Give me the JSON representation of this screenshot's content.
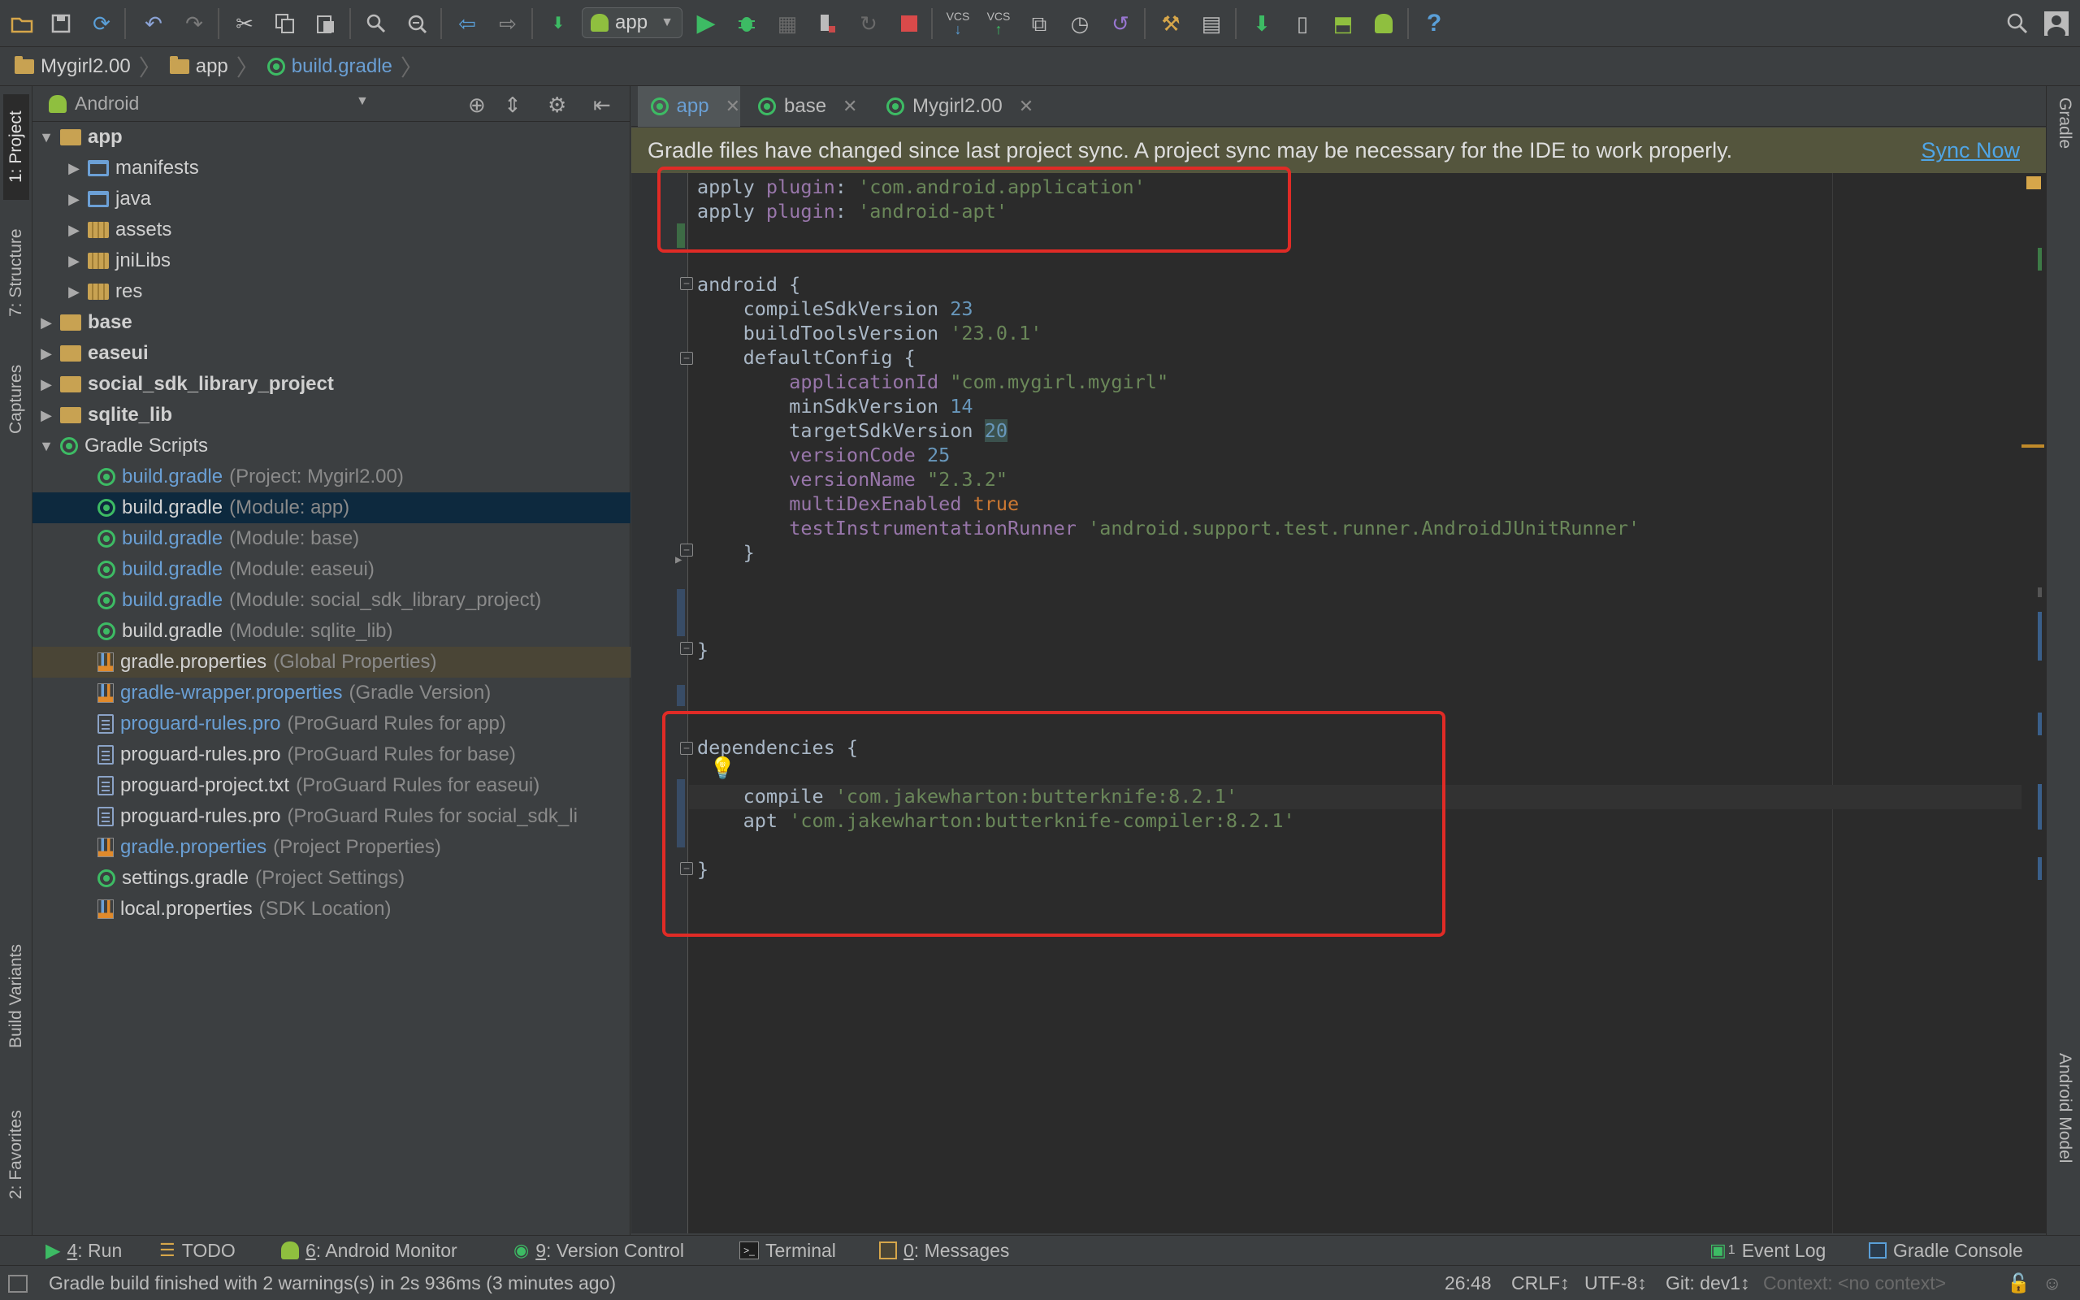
{
  "toolbar": {
    "run_config": "app",
    "icons": [
      "open-folder-icon",
      "save-icon",
      "sync-icon",
      "undo-icon",
      "redo-icon",
      "cut-icon",
      "copy-icon",
      "paste-icon",
      "find-icon",
      "replace-icon",
      "back-icon",
      "forward-icon",
      "make-project-icon",
      "run-icon",
      "debug-icon",
      "attach-debugger-icon",
      "run-coverage-icon",
      "apply-changes-icon",
      "stop-icon",
      "vcs-update-icon",
      "vcs-commit-icon",
      "vcs-compare-icon",
      "vcs-history-icon",
      "vcs-revert-icon",
      "project-structure-icon",
      "sdk-manager-icon",
      "avd-manager-icon",
      "sync-gradle-icon",
      "android-monitor-icon",
      "android-icon",
      "help-icon",
      "search-everywhere-icon",
      "user-icon"
    ],
    "vcs_label": "VCS"
  },
  "breadcrumb": [
    "Mygirl2.00",
    "app",
    "build.gradle"
  ],
  "left_strip": {
    "project": "1: Project",
    "structure": "7: Structure",
    "captures": "Captures",
    "build_variants": "Build Variants",
    "favorites": "2: Favorites"
  },
  "right_strip": {
    "gradle": "Gradle",
    "android_model": "Android Model"
  },
  "project_panel": {
    "view_mode": "Android",
    "tree": [
      {
        "label": "app",
        "hint": "",
        "depth": 0,
        "arrow": "down",
        "icon": "folder-gold",
        "style": "bold"
      },
      {
        "label": "manifests",
        "hint": "",
        "depth": 1,
        "arrow": "right",
        "icon": "folder-blue",
        "style": "white"
      },
      {
        "label": "java",
        "hint": "",
        "depth": 1,
        "arrow": "right",
        "icon": "folder-blue",
        "style": "white"
      },
      {
        "label": "assets",
        "hint": "",
        "depth": 1,
        "arrow": "right",
        "icon": "folder-stripes",
        "style": "white"
      },
      {
        "label": "jniLibs",
        "hint": "",
        "depth": 1,
        "arrow": "right",
        "icon": "folder-stripes",
        "style": "white"
      },
      {
        "label": "res",
        "hint": "",
        "depth": 1,
        "arrow": "right",
        "icon": "folder-stripes",
        "style": "white"
      },
      {
        "label": "base",
        "hint": "",
        "depth": 0,
        "arrow": "right",
        "icon": "folder-gold",
        "style": "bold"
      },
      {
        "label": "easeui",
        "hint": "",
        "depth": 0,
        "arrow": "right",
        "icon": "folder-gold",
        "style": "bold"
      },
      {
        "label": "social_sdk_library_project",
        "hint": "",
        "depth": 0,
        "arrow": "right",
        "icon": "folder-gold",
        "style": "bold"
      },
      {
        "label": "sqlite_lib",
        "hint": "",
        "depth": 0,
        "arrow": "right",
        "icon": "folder-gold",
        "style": "bold"
      },
      {
        "label": "Gradle Scripts",
        "hint": "",
        "depth": 0,
        "arrow": "down",
        "icon": "gradle",
        "style": "white"
      },
      {
        "label": "build.gradle",
        "hint": "(Project: Mygirl2.00)",
        "depth": 1,
        "arrow": "",
        "icon": "gradle",
        "style": "blue"
      },
      {
        "label": "build.gradle",
        "hint": "(Module: app)",
        "depth": 1,
        "arrow": "",
        "icon": "gradle",
        "style": "white",
        "selected": true
      },
      {
        "label": "build.gradle",
        "hint": "(Module: base)",
        "depth": 1,
        "arrow": "",
        "icon": "gradle",
        "style": "blue"
      },
      {
        "label": "build.gradle",
        "hint": "(Module: easeui)",
        "depth": 1,
        "arrow": "",
        "icon": "gradle",
        "style": "blue"
      },
      {
        "label": "build.gradle",
        "hint": "(Module: social_sdk_library_project)",
        "depth": 1,
        "arrow": "",
        "icon": "gradle",
        "style": "blue"
      },
      {
        "label": "build.gradle",
        "hint": "(Module: sqlite_lib)",
        "depth": 1,
        "arrow": "",
        "icon": "gradle",
        "style": "white"
      },
      {
        "label": "gradle.properties",
        "hint": "(Global Properties)",
        "depth": 1,
        "arrow": "",
        "icon": "props",
        "style": "white",
        "highlight": true
      },
      {
        "label": "gradle-wrapper.properties",
        "hint": "(Gradle Version)",
        "depth": 1,
        "arrow": "",
        "icon": "props",
        "style": "blue"
      },
      {
        "label": "proguard-rules.pro",
        "hint": "(ProGuard Rules for app)",
        "depth": 1,
        "arrow": "",
        "icon": "file",
        "style": "blue"
      },
      {
        "label": "proguard-rules.pro",
        "hint": "(ProGuard Rules for base)",
        "depth": 1,
        "arrow": "",
        "icon": "file",
        "style": "white"
      },
      {
        "label": "proguard-project.txt",
        "hint": "(ProGuard Rules for easeui)",
        "depth": 1,
        "arrow": "",
        "icon": "file",
        "style": "white"
      },
      {
        "label": "proguard-rules.pro",
        "hint": "(ProGuard Rules for social_sdk_li",
        "depth": 1,
        "arrow": "",
        "icon": "file",
        "style": "white"
      },
      {
        "label": "gradle.properties",
        "hint": "(Project Properties)",
        "depth": 1,
        "arrow": "",
        "icon": "props",
        "style": "blue"
      },
      {
        "label": "settings.gradle",
        "hint": "(Project Settings)",
        "depth": 1,
        "arrow": "",
        "icon": "gradle",
        "style": "white"
      },
      {
        "label": "local.properties",
        "hint": "(SDK Location)",
        "depth": 1,
        "arrow": "",
        "icon": "props",
        "style": "white"
      }
    ]
  },
  "editor": {
    "tabs": [
      {
        "label": "app",
        "active": true
      },
      {
        "label": "base",
        "active": false
      },
      {
        "label": "Mygirl2.00",
        "active": false
      }
    ],
    "banner_text": "Gradle files have changed since last project sync. A project sync may be necessary for the IDE to work properly.",
    "banner_action": "Sync Now",
    "code": [
      [
        [
          "apply ",
          "plain"
        ],
        [
          "plugin",
          "purple"
        ],
        [
          ": ",
          "plain"
        ],
        [
          "'com.android.application'",
          "str"
        ]
      ],
      [
        [
          "apply ",
          "plain"
        ],
        [
          "plugin",
          "purple"
        ],
        [
          ": ",
          "plain"
        ],
        [
          "'android-apt'",
          "str"
        ]
      ],
      [],
      [],
      [
        [
          "android {",
          "plain"
        ]
      ],
      [
        [
          "    compileSdkVersion ",
          "plain"
        ],
        [
          "23",
          "num"
        ]
      ],
      [
        [
          "    buildToolsVersion ",
          "plain"
        ],
        [
          "'23.0.1'",
          "str"
        ]
      ],
      [
        [
          "    defaultConfig {",
          "plain"
        ]
      ],
      [
        [
          "        ",
          "plain"
        ],
        [
          "applicationId",
          "purple"
        ],
        [
          " ",
          "plain"
        ],
        [
          "\"com.mygirl.mygirl\"",
          "str"
        ]
      ],
      [
        [
          "        minSdkVersion ",
          "plain"
        ],
        [
          "14",
          "num"
        ]
      ],
      [
        [
          "        targetSdkVersion ",
          "plain"
        ],
        [
          "20",
          "numhl"
        ]
      ],
      [
        [
          "        ",
          "plain"
        ],
        [
          "versionCode",
          "purple"
        ],
        [
          " ",
          "plain"
        ],
        [
          "25",
          "num"
        ]
      ],
      [
        [
          "        ",
          "plain"
        ],
        [
          "versionName",
          "purple"
        ],
        [
          " ",
          "plain"
        ],
        [
          "\"2.3.2\"",
          "str"
        ]
      ],
      [
        [
          "        ",
          "plain"
        ],
        [
          "multiDexEnabled",
          "purple"
        ],
        [
          " ",
          "plain"
        ],
        [
          "true",
          "kw"
        ]
      ],
      [
        [
          "        ",
          "plain"
        ],
        [
          "testInstrumentationRunner",
          "purple"
        ],
        [
          " ",
          "plain"
        ],
        [
          "'android.support.test.runner.AndroidJUnitRunner'",
          "str"
        ]
      ],
      [
        [
          "    }",
          "plain"
        ]
      ],
      [],
      [],
      [],
      [
        [
          "}",
          "plain"
        ]
      ],
      [],
      [],
      [],
      [
        [
          "dependencies {",
          "plain"
        ]
      ],
      [],
      [
        [
          "    compile ",
          "plain"
        ],
        [
          "'com.jakewharton:butterknife:8.2.1'",
          "str"
        ]
      ],
      [
        [
          "    apt ",
          "plain"
        ],
        [
          "'com.jakewharton:butterknife-compiler:8.2.1'",
          "str"
        ]
      ],
      [],
      [
        [
          "}",
          "plain"
        ]
      ]
    ]
  },
  "bottom_tools": [
    {
      "prefix": "4",
      "label": ": Run",
      "icon": "run-icon"
    },
    {
      "prefix": "",
      "label": "TODO",
      "icon": "todo-icon"
    },
    {
      "prefix": "6",
      "label": ": Android Monitor",
      "icon": "android-icon"
    },
    {
      "prefix": "9",
      "label": ": Version Control",
      "icon": "vcs-icon"
    },
    {
      "prefix": "",
      "label": "Terminal",
      "icon": "terminal-icon"
    },
    {
      "prefix": "0",
      "label": ": Messages",
      "icon": "messages-icon"
    }
  ],
  "bottom_right_tools": [
    {
      "label": "Event Log",
      "badge": "1"
    },
    {
      "label": "Gradle Console"
    }
  ],
  "status": {
    "message": "Gradle build finished with 2 warnings(s) in 2s 936ms (3 minutes ago)",
    "position": "26:48",
    "line_sep": "CRLF↕",
    "encoding": "UTF-8↕",
    "git": "Git: dev1↕",
    "context": "Context: <no context>"
  },
  "colors": {
    "accent_green": "#3dbb64",
    "annotation_red": "#e02b26",
    "selection": "#0d293e",
    "banner": "#54553d",
    "link": "#4fa5e6"
  }
}
